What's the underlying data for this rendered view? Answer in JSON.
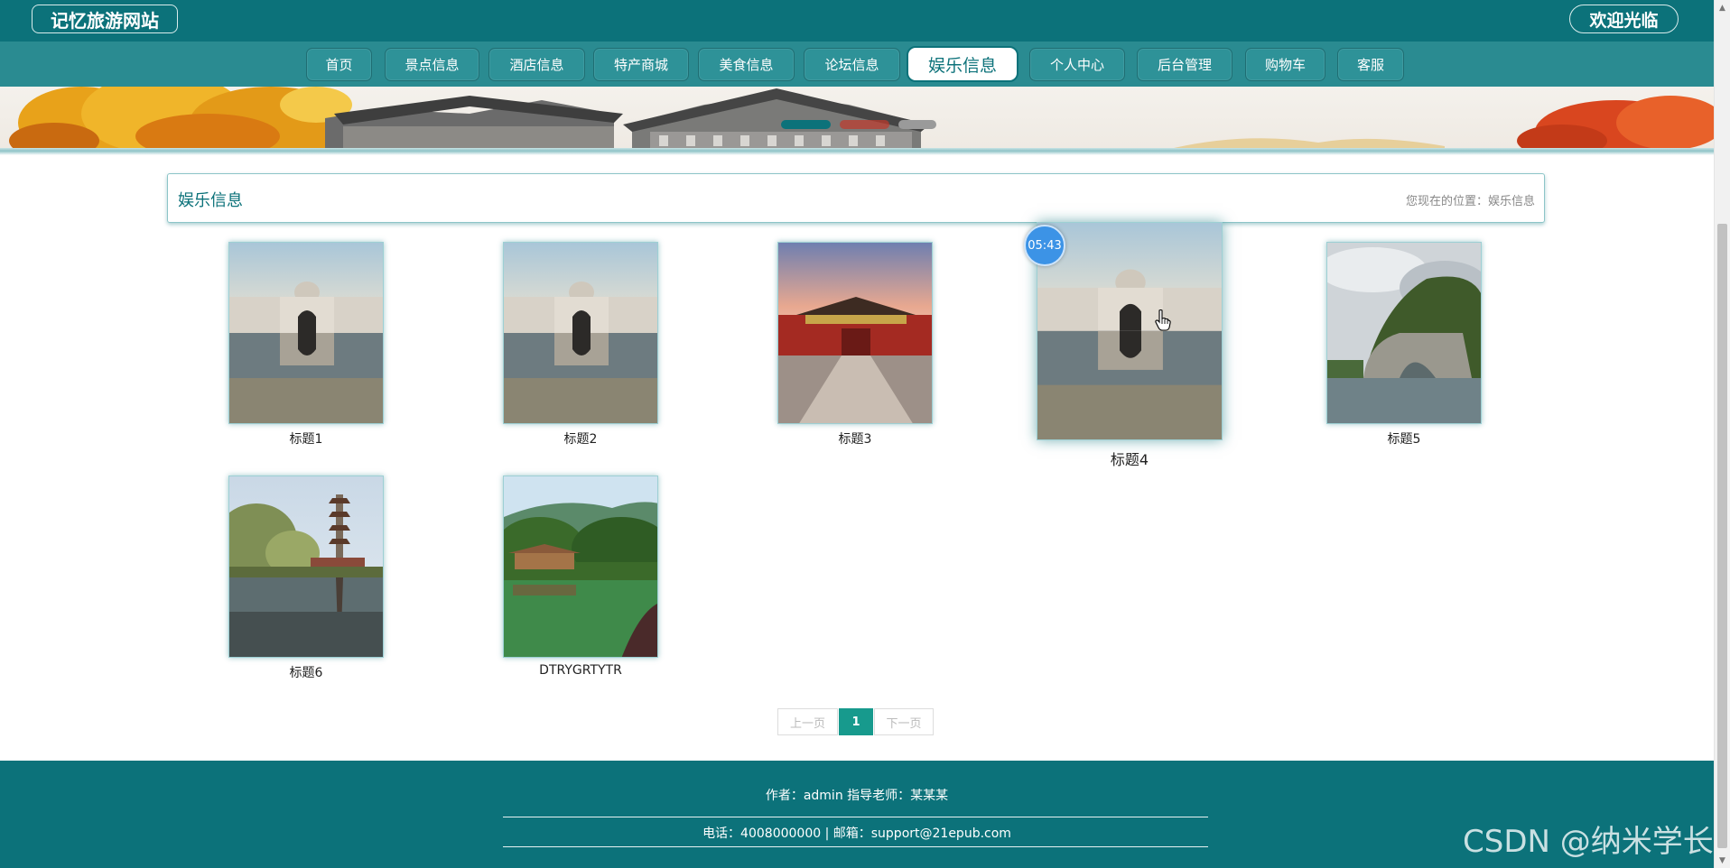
{
  "header": {
    "brand": "记忆旅游网站",
    "welcome": "欢迎光临"
  },
  "nav": {
    "items": [
      "首页",
      "景点信息",
      "酒店信息",
      "特产商城",
      "美食信息",
      "论坛信息",
      "娱乐信息",
      "个人中心",
      "后台管理",
      "购物车",
      "客服"
    ],
    "active": "娱乐信息"
  },
  "panel": {
    "title": "娱乐信息",
    "location": "您现在的位置：娱乐信息"
  },
  "items": [
    {
      "caption": "标题1",
      "image": "mosque-reflection"
    },
    {
      "caption": "标题2",
      "image": "mosque-reflection"
    },
    {
      "caption": "标题3",
      "image": "palace-gate-sunset"
    },
    {
      "caption": "标题4",
      "image": "mosque-reflection"
    },
    {
      "caption": "标题5",
      "image": "elephant-trunk-hill"
    },
    {
      "caption": "标题6",
      "image": "pagoda-lake"
    },
    {
      "caption": "DTRYGRTYTR",
      "image": "pavilion-lake"
    }
  ],
  "hover_timer": "05:43",
  "pagination": {
    "prev": "上一页",
    "current": "1",
    "next": "下一页"
  },
  "footer": {
    "line1": "作者：admin 指导老师：某某某",
    "line2": "电话：4008000000 | 邮箱：support@21epub.com"
  },
  "watermark": "CSDN @纳米学长",
  "colors": {
    "primary": "#0c727a",
    "nav": "#2a8b91",
    "pager_active": "#179a8d",
    "badge": "#3c93e6"
  }
}
